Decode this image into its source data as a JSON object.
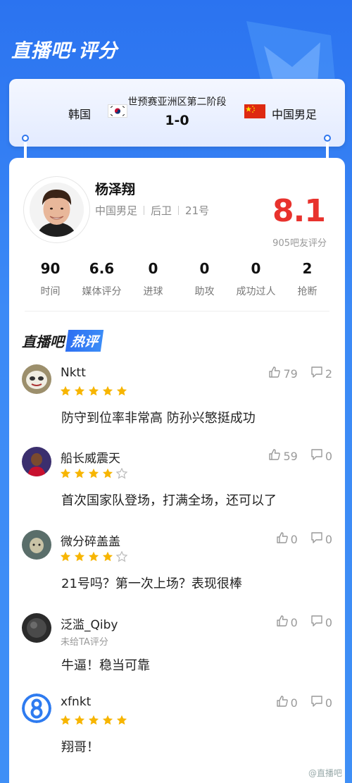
{
  "header": {
    "title": "直播吧·评分"
  },
  "match": {
    "league": "世预赛亚洲区第二阶段",
    "home": "韩国",
    "away": "中国男足",
    "score": "1-0"
  },
  "player": {
    "name": "杨泽翔",
    "team": "中国男足",
    "position": "后卫",
    "number": "21号",
    "rating": "8.1",
    "rating_count": "905吧友评分"
  },
  "stats": [
    {
      "value": "90",
      "label": "时间"
    },
    {
      "value": "6.6",
      "label": "媒体评分"
    },
    {
      "value": "0",
      "label": "进球"
    },
    {
      "value": "0",
      "label": "助攻"
    },
    {
      "value": "0",
      "label": "成功过人"
    },
    {
      "value": "2",
      "label": "抢断"
    }
  ],
  "hot": {
    "prefix": "直播吧",
    "tag": "热评"
  },
  "comments": [
    {
      "user": "Nktt",
      "stars": 5,
      "sub": "",
      "text": "防守到位率非常高 防孙兴慜挺成功",
      "likes": "79",
      "replies": "2"
    },
    {
      "user": "船长威震天",
      "stars": 4,
      "sub": "",
      "text": "首次国家队登场，打满全场，还可以了",
      "likes": "59",
      "replies": "0"
    },
    {
      "user": "微分碎盖盖",
      "stars": 4,
      "sub": "",
      "text": "21号吗？第一次上场？表现很棒",
      "likes": "0",
      "replies": "0"
    },
    {
      "user": "泛滥_Qiby",
      "stars": 0,
      "sub": "未给TA评分",
      "text": "牛逼！稳当可靠",
      "likes": "0",
      "replies": "0"
    },
    {
      "user": "xfnkt",
      "stars": 5,
      "sub": "",
      "text": "翔哥！",
      "likes": "0",
      "replies": "0"
    }
  ],
  "watermark": "@直播吧",
  "colors": {
    "brand_blue": "#2e76ee",
    "rating_red": "#e8322d",
    "star_yellow": "#f7b500"
  }
}
